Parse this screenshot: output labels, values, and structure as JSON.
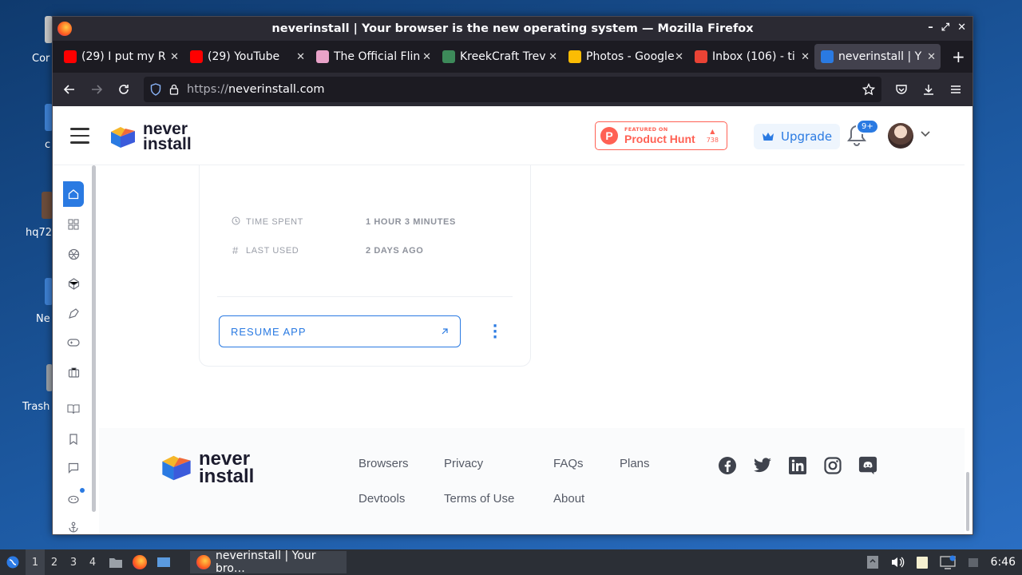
{
  "desktop": {
    "icons": [
      {
        "label": "Cor"
      },
      {
        "label": "c"
      },
      {
        "label": "hq72"
      },
      {
        "label": "Ne"
      },
      {
        "label": "Trash"
      }
    ]
  },
  "window": {
    "title": "neverinstall | Your browser is the new operating system — Mozilla Firefox",
    "controls": {
      "minimize": "–",
      "maximize": "⤢",
      "close": "✕"
    }
  },
  "tabs": [
    {
      "label": "(29) I put my R",
      "favicon_color": "#ff0000"
    },
    {
      "label": "(29) YouTube",
      "favicon_color": "#ff0000"
    },
    {
      "label": "The Official Flin",
      "favicon_color": "#e8a2c8"
    },
    {
      "label": "KreekCraft Trev",
      "favicon_color": "#3d8a5a"
    },
    {
      "label": "Photos - Google",
      "favicon_color": "#fbbc04"
    },
    {
      "label": "Inbox (106) - ti",
      "favicon_color": "#ea4335"
    },
    {
      "label": "neverinstall | Y",
      "favicon_color": "#2a7ae2",
      "active": true
    }
  ],
  "navbar": {
    "url_prefix": "https://",
    "url_domain": "neverinstall.com"
  },
  "app": {
    "logo_line1": "never",
    "logo_line2": "install",
    "product_hunt": {
      "featured": "FEATURED ON",
      "name": "Product Hunt",
      "votes": "738"
    },
    "upgrade_label": "Upgrade",
    "notification_badge": "9+",
    "card": {
      "time_spent_label": "TIME SPENT",
      "time_spent_value": "1 HOUR 3 MINUTES",
      "last_used_label": "LAST USED",
      "last_used_value": "2 DAYS AGO",
      "resume_label": "RESUME APP"
    },
    "footer": {
      "links": [
        "Browsers",
        "Privacy",
        "FAQs",
        "Plans",
        "Devtools",
        "Terms of Use",
        "About"
      ]
    },
    "colors": {
      "accent": "#2a7ae2",
      "producthunt": "#ff6154"
    }
  },
  "taskbar": {
    "workspaces": [
      "1",
      "2",
      "3",
      "4"
    ],
    "window_label": "neverinstall | Your bro…",
    "clock": "6:46"
  }
}
